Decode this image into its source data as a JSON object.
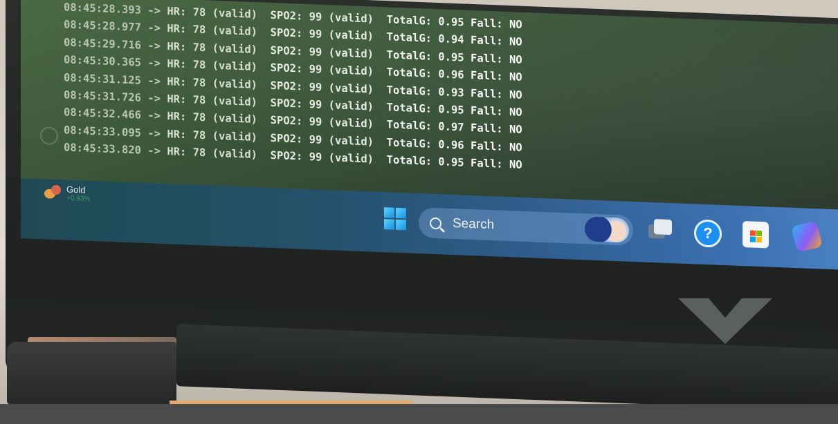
{
  "log": {
    "lines": [
      {
        "timestamp": "08:45:28.393",
        "arrow": "->",
        "hr": "HR: 78 (valid)",
        "spo2": "SPO2: 99 (valid)",
        "totalg": "TotalG: 0.95",
        "fall": "Fall: NO"
      },
      {
        "timestamp": "08:45:28.977",
        "arrow": "->",
        "hr": "HR: 78 (valid)",
        "spo2": "SPO2: 99 (valid)",
        "totalg": "TotalG: 0.94",
        "fall": "Fall: NO"
      },
      {
        "timestamp": "08:45:29.716",
        "arrow": "->",
        "hr": "HR: 78 (valid)",
        "spo2": "SPO2: 99 (valid)",
        "totalg": "TotalG: 0.95",
        "fall": "Fall: NO"
      },
      {
        "timestamp": "08:45:30.365",
        "arrow": "->",
        "hr": "HR: 78 (valid)",
        "spo2": "SPO2: 99 (valid)",
        "totalg": "TotalG: 0.96",
        "fall": "Fall: NO"
      },
      {
        "timestamp": "08:45:31.125",
        "arrow": "->",
        "hr": "HR: 78 (valid)",
        "spo2": "SPO2: 99 (valid)",
        "totalg": "TotalG: 0.93",
        "fall": "Fall: NO"
      },
      {
        "timestamp": "08:45:31.726",
        "arrow": "->",
        "hr": "HR: 78 (valid)",
        "spo2": "SPO2: 99 (valid)",
        "totalg": "TotalG: 0.95",
        "fall": "Fall: NO"
      },
      {
        "timestamp": "08:45:32.466",
        "arrow": "->",
        "hr": "HR: 78 (valid)",
        "spo2": "SPO2: 99 (valid)",
        "totalg": "TotalG: 0.97",
        "fall": "Fall: NO"
      },
      {
        "timestamp": "08:45:33.095",
        "arrow": "->",
        "hr": "HR: 78 (valid)",
        "spo2": "SPO2: 99 (valid)",
        "totalg": "TotalG: 0.96",
        "fall": "Fall: NO"
      },
      {
        "timestamp": "08:45:33.820",
        "arrow": "->",
        "hr": "HR: 78 (valid)",
        "spo2": "SPO2: 99 (valid)",
        "totalg": "TotalG: 0.95",
        "fall": "Fall: NO"
      }
    ]
  },
  "taskbar": {
    "widget": {
      "title": "Gold",
      "change": "+0.93%",
      "icon": "weather-market-widget-icon"
    },
    "start_icon": "windows-start-icon",
    "search": {
      "label": "Search",
      "icon": "search-icon",
      "highlight_icon": "search-highlight-icon"
    },
    "pinned": [
      {
        "name": "task-view-icon"
      },
      {
        "name": "help-icon",
        "glyph": "?"
      },
      {
        "name": "microsoft-store-icon"
      },
      {
        "name": "copilot-icon"
      }
    ],
    "colors": {
      "start_icon": "#1a8fe0",
      "help_icon": "#1d8ff0"
    }
  },
  "device": {
    "logo_icon": "v-logo-icon"
  }
}
